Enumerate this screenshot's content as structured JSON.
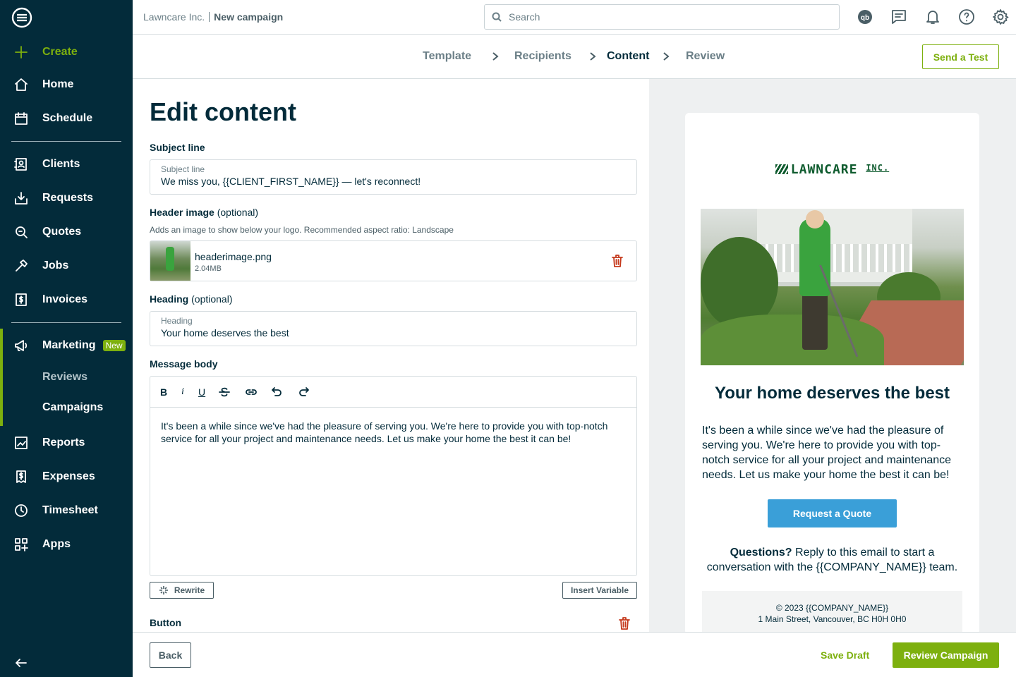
{
  "sidebar": {
    "create": "Create",
    "items": [
      {
        "label": "Home"
      },
      {
        "label": "Schedule"
      },
      {
        "label": "Clients"
      },
      {
        "label": "Requests"
      },
      {
        "label": "Quotes"
      },
      {
        "label": "Jobs"
      },
      {
        "label": "Invoices"
      },
      {
        "label": "Marketing",
        "badge": "New"
      },
      {
        "label": "Reports"
      },
      {
        "label": "Expenses"
      },
      {
        "label": "Timesheet"
      },
      {
        "label": "Apps"
      }
    ],
    "sub_items": [
      {
        "label": "Reviews"
      },
      {
        "label": "Campaigns"
      }
    ]
  },
  "topbar": {
    "company": "Lawncare Inc.",
    "page": "New campaign",
    "search_placeholder": "Search"
  },
  "stepper": {
    "steps": [
      "Template",
      "Recipients",
      "Content",
      "Review"
    ],
    "active": "Content",
    "send_test": "Send a Test"
  },
  "form": {
    "title": "Edit content",
    "subject": {
      "label": "Subject line",
      "field_label": "Subject line",
      "value": "We miss you, {{CLIENT_FIRST_NAME}} — let's reconnect!"
    },
    "header_image": {
      "label": "Header image",
      "optional": "(optional)",
      "hint": "Adds an image to show below your logo. Recommended aspect ratio: Landscape",
      "file_name": "headerimage.png",
      "file_size": "2.04MB"
    },
    "heading": {
      "label": "Heading",
      "optional": "(optional)",
      "field_label": "Heading",
      "value": "Your home deserves the best"
    },
    "message": {
      "label": "Message body",
      "value": "It's been a while since we've had the pleasure of serving you. We're here to provide you with top-notch service for all your project and maintenance needs. Let us make your home the best it can be!"
    },
    "toolbar": {
      "bold": "B",
      "italic": "i",
      "underline": "U"
    },
    "rewrite": "Rewrite",
    "insert_variable": "Insert Variable",
    "button_label": "Button"
  },
  "preview": {
    "brand": "LAWNCARE",
    "brand_suffix": "INC.",
    "title": "Your home deserves the best",
    "body": "It's been a while since we've had the pleasure of serving you. We're here to provide you with top-notch service for all your project and maintenance needs. Let us make your home the best it can be!",
    "cta": "Request a Quote",
    "questions_bold": "Questions?",
    "questions_rest": " Reply to this email to start a conversation with the {{COMPANY_NAME}} team.",
    "footer_line1": "© 2023 {{COMPANY_NAME}}",
    "footer_line2": "1 Main Street, Vancouver, BC H0H 0H0"
  },
  "bottom": {
    "back": "Back",
    "save_draft": "Save Draft",
    "review": "Review Campaign"
  },
  "colors": {
    "sidebar": "#032b3a",
    "accent": "#7db00e",
    "cta": "#3a9fd8",
    "danger": "#c5391c"
  },
  "icons": {
    "search": "search-icon",
    "quickbooks": "quickbooks-icon",
    "messages": "chat-icon",
    "notifications": "bell-icon",
    "help": "help-icon",
    "settings": "gear-icon"
  }
}
